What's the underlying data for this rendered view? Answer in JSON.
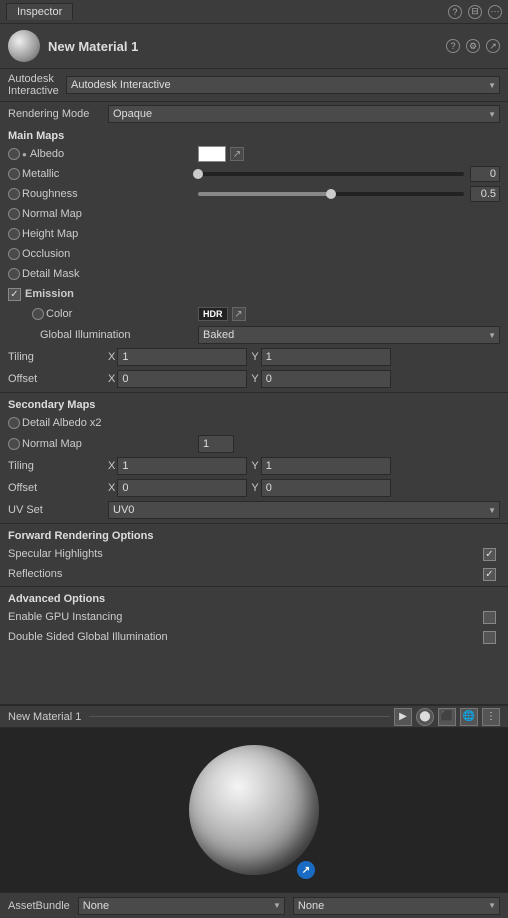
{
  "titleBar": {
    "tabLabel": "Inspector",
    "icons": [
      "?",
      "=",
      "x"
    ]
  },
  "material": {
    "name": "New Material 1",
    "shader": "Autodesk Interactive"
  },
  "renderingMode": {
    "label": "Rendering Mode",
    "value": "Opaque"
  },
  "mainMaps": {
    "header": "Main Maps",
    "albedo": {
      "label": "Albedo"
    },
    "metallic": {
      "label": "Metallic",
      "sliderPos": 0,
      "value": "0"
    },
    "roughness": {
      "label": "Roughness",
      "sliderPos": 50,
      "value": "0.5"
    },
    "normalMap": {
      "label": "Normal Map"
    },
    "heightMap": {
      "label": "Height Map"
    },
    "occlusion": {
      "label": "Occlusion"
    },
    "detailMask": {
      "label": "Detail Mask"
    }
  },
  "emission": {
    "label": "Emission",
    "color": {
      "label": "Color",
      "hdr": "HDR"
    },
    "globalIllumination": {
      "label": "Global Illumination",
      "value": "Baked"
    }
  },
  "tiling": {
    "label": "Tiling",
    "x": "1",
    "y": "1"
  },
  "offset": {
    "label": "Offset",
    "x": "0",
    "y": "0"
  },
  "secondaryMaps": {
    "header": "Secondary Maps",
    "detailAlbedo": {
      "label": "Detail Albedo x2"
    },
    "normalMap": {
      "label": "Normal Map",
      "value": "1"
    }
  },
  "tiling2": {
    "label": "Tiling",
    "x": "1",
    "y": "1"
  },
  "offset2": {
    "label": "Offset",
    "x": "0",
    "y": "0"
  },
  "uvSet": {
    "label": "UV Set",
    "value": "UV0"
  },
  "forwardRendering": {
    "header": "Forward Rendering Options",
    "specularHighlights": {
      "label": "Specular Highlights",
      "checked": true
    },
    "reflections": {
      "label": "Reflections",
      "checked": true
    }
  },
  "advancedOptions": {
    "header": "Advanced Options",
    "enableGPU": {
      "label": "Enable GPU Instancing",
      "checked": false
    },
    "doubleSided": {
      "label": "Double Sided Global Illumination",
      "checked": false
    }
  },
  "preview": {
    "name": "New Material 1"
  },
  "assetBundle": {
    "label": "AssetBundle",
    "value": "None",
    "value2": "None"
  }
}
